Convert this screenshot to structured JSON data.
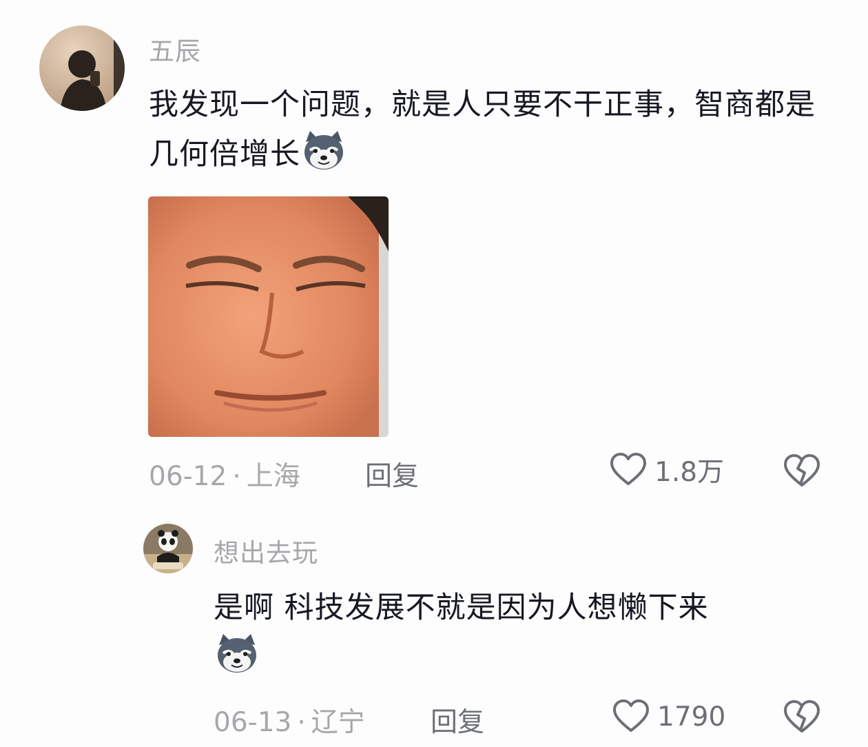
{
  "comments": [
    {
      "username": "五辰",
      "text": "我发现一个问题，就是人只要不干正事，智商都是几何倍增长",
      "emoji": "husky-smirk-emoji",
      "has_image": true,
      "date": "06-12",
      "location": "上海",
      "reply_label": "回复",
      "likes": "1.8万"
    },
    {
      "username": "想出去玩",
      "text": "是啊 科技发展不就是因为人想懒下来",
      "emoji": "husky-smirk-emoji",
      "date": "06-13",
      "location": "辽宁",
      "reply_label": "回复",
      "likes": "1790"
    }
  ],
  "separator": "·",
  "icons": {
    "like": "heart-outline-icon",
    "dislike": "broken-heart-icon"
  }
}
